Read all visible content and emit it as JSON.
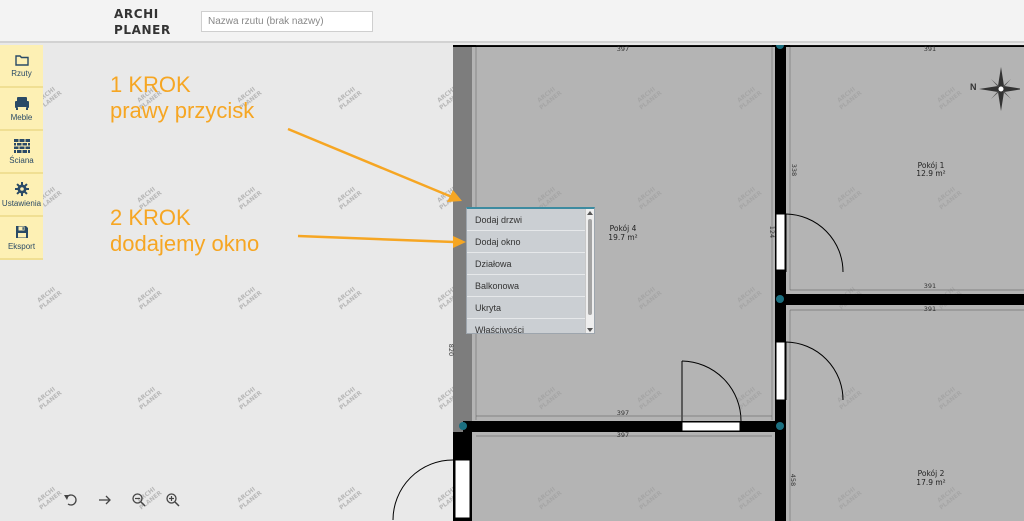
{
  "app": {
    "logo_line1": "ARCHI",
    "logo_line2": "PLANER",
    "plan_name_placeholder": "Nazwa rzutu (brak nazwy)",
    "plan_name_value": ""
  },
  "sidebar": {
    "items": [
      {
        "label": "Rzuty",
        "icon": "folder-icon"
      },
      {
        "label": "Meble",
        "icon": "armchair-icon"
      },
      {
        "label": "Ściana",
        "icon": "brick-wall-icon"
      },
      {
        "label": "Ustawienia",
        "icon": "gear-icon"
      },
      {
        "label": "Eksport",
        "icon": "floppy-disk-icon"
      }
    ]
  },
  "annotations": {
    "step1_title": "1 KROK",
    "step1_desc": "prawy przycisk",
    "step2_title": "2 KROK",
    "step2_desc": "dodajemy okno",
    "color": "#f6a623"
  },
  "context_menu": {
    "items": [
      "Dodaj drzwi",
      "Dodaj okno",
      "Działowa",
      "Balkonowa",
      "Ukryta",
      "Właściwości"
    ]
  },
  "rooms": [
    {
      "name": "Pokój 4",
      "area": "19.7 m²"
    },
    {
      "name": "Pokój 1",
      "area": "12.9 m²"
    },
    {
      "name": "Pokój 2",
      "area": "17.9 m²"
    }
  ],
  "dimensions": {
    "top_left": "397",
    "top_right": "391",
    "middle_right_top": "391",
    "middle_right_bottom": "391",
    "bottom_top": "397",
    "bottom_bottom": "397",
    "left_vertical": "820",
    "right_vertical_top": "338",
    "right_vertical_door": "124",
    "right_vertical_bottom": "458"
  },
  "watermark": {
    "line1": "ARCHI",
    "line2": "PLANER"
  },
  "compass": {
    "label": "N"
  },
  "toolbar": {
    "tools": [
      "undo-icon",
      "redo-icon",
      "zoom-out-icon",
      "zoom-in-icon"
    ]
  },
  "colors": {
    "room_fill": "#b4b4b4",
    "wall": "#000000",
    "gray_wall": "#7d7d7d",
    "node": "#1b6f80",
    "sidebar_bg": "#fdf0b4",
    "menu_accent": "#3d8ba0"
  }
}
